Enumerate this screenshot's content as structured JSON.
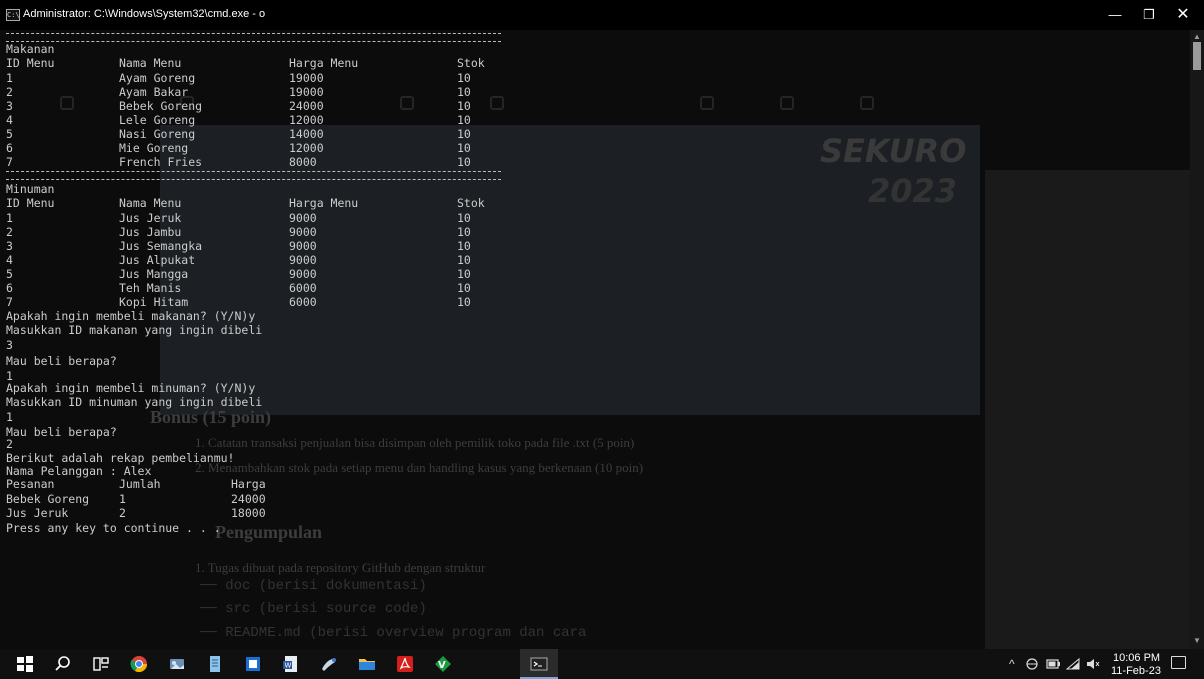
{
  "window": {
    "title": "Administrator: C:\\Windows\\System32\\cmd.exe - o",
    "icon_text": "C:\\",
    "min": "—",
    "max": "❐",
    "close": "✕"
  },
  "console": {
    "divider1": "================================================================",
    "makanan": {
      "section": "Makanan",
      "headers": [
        "ID Menu",
        "Nama Menu",
        "Harga Menu",
        "Stok"
      ],
      "rows": [
        [
          "1",
          "Ayam Goreng",
          "19000",
          "10"
        ],
        [
          "2",
          "Ayam Bakar",
          "19000",
          "10"
        ],
        [
          "3",
          "Bebek Goreng",
          "24000",
          "10"
        ],
        [
          "4",
          "Lele Goreng",
          "12000",
          "10"
        ],
        [
          "5",
          "Nasi Goreng",
          "14000",
          "10"
        ],
        [
          "6",
          "Mie Goreng",
          "12000",
          "10"
        ],
        [
          "7",
          "French Fries",
          "8000",
          "10"
        ]
      ]
    },
    "minuman": {
      "section": "Minuman",
      "headers": [
        "ID Menu",
        "Nama Menu",
        "Harga Menu",
        "Stok"
      ],
      "rows": [
        [
          "1",
          "Jus Jeruk",
          "9000",
          "10"
        ],
        [
          "2",
          "Jus Jambu",
          "9000",
          "10"
        ],
        [
          "3",
          "Jus Semangka",
          "9000",
          "10"
        ],
        [
          "4",
          "Jus Alpukat",
          "9000",
          "10"
        ],
        [
          "5",
          "Jus Mangga",
          "9000",
          "10"
        ],
        [
          "6",
          "Teh Manis",
          "6000",
          "10"
        ],
        [
          "7",
          "Kopi Hitam",
          "6000",
          "10"
        ]
      ]
    },
    "dialog": [
      "Apakah ingin membeli makanan? (Y/N)y",
      "Masukkan ID makanan yang ingin dibeli",
      "3",
      "Mau beli berapa?",
      "1",
      "Apakah ingin membeli minuman? (Y/N)y",
      "Masukkan ID minuman yang ingin dibeli",
      "1",
      "Mau beli berapa?",
      "2",
      "Berikut adalah rekap pembelianmu!",
      "Nama Pelanggan : Alex"
    ],
    "recap": {
      "headers": [
        "Pesanan",
        "Jumlah",
        "Harga"
      ],
      "rows": [
        [
          "Bebek Goreng",
          "1",
          "24000"
        ],
        [
          "Jus Jeruk",
          "2",
          "18000"
        ]
      ]
    },
    "footer": "Press any key to continue . . ."
  },
  "background_window": {
    "logo_text": "SEKURO",
    "logo_year": "2023",
    "bonus_heading": "Bonus (15 poin)",
    "bonus_items": [
      "1.   Catatan transaksi penjualan bisa disimpan oleh pemilik toko pada file .txt (5 poin)",
      "2.   Menambahkan stok pada setiap menu dan handling kasus yang berkenaan (10 poin)"
    ],
    "pengumpulan_heading": "Pengumpulan",
    "pengumpulan_item": "1.   Tugas dibuat pada repository GitHub dengan struktur",
    "tree": [
      "── doc (berisi dokumentasi)",
      "── src (berisi source code)",
      "── README.md (berisi overview program dan cara"
    ]
  },
  "taskbar": {
    "icons": [
      "windows-start-icon",
      "search-icon",
      "task-view-icon",
      "chrome-icon",
      "file-explorer-photos-icon",
      "notepad-icon",
      "vscode-blue-icon",
      "word-icon",
      "paint-icon",
      "folder-icon",
      "acrobat-icon",
      "vim-icon",
      "cmd-icon"
    ],
    "tray": {
      "chevron": "^",
      "time": "10:06 PM",
      "date": "11-Feb-23"
    }
  }
}
